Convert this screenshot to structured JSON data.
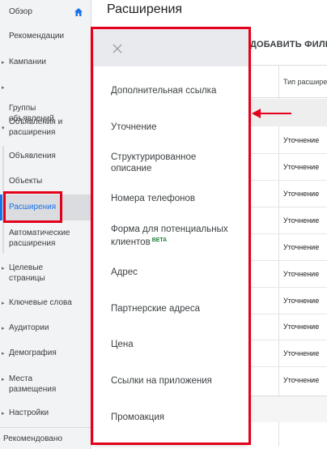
{
  "sidebar": {
    "items": [
      {
        "label": "Обзор"
      },
      {
        "label": "Рекомендации"
      },
      {
        "label": "Кампании"
      },
      {
        "label": "Группы\nобъявлений"
      },
      {
        "label": "Объявления и\nрасширения"
      },
      {
        "label": "Объявления"
      },
      {
        "label": "Объекты"
      },
      {
        "label": "Расширения"
      },
      {
        "label": "Автоматические\nрасширения"
      },
      {
        "label": "Целевые\nстраницы"
      },
      {
        "label": "Ключевые слова"
      },
      {
        "label": "Аудитории"
      },
      {
        "label": "Демография"
      },
      {
        "label": "Места\nразмещения"
      },
      {
        "label": "Настройки"
      }
    ],
    "footer_label": "Рекомендовано"
  },
  "main": {
    "title": "Расширения",
    "filter_label": "ДОБАВИТЬ ФИЛЬТР",
    "column_header": "Тип расширения",
    "cells": [
      "Уточнение",
      "Уточнение",
      "Уточнение",
      "Уточнение",
      "Уточнение",
      "Уточнение",
      "Уточнение",
      "Уточнение",
      "Уточнение",
      "Уточнение"
    ]
  },
  "dropdown": {
    "items": [
      {
        "label": "Дополнительная ссылка"
      },
      {
        "label": "Уточнение"
      },
      {
        "label": "Структурированное\nописание"
      },
      {
        "label": "Номера телефонов"
      },
      {
        "label": "Форма для потенциальных\nклиентов",
        "badge": "BETA"
      },
      {
        "label": "Адрес"
      },
      {
        "label": "Партнерские адреса"
      },
      {
        "label": "Цена"
      },
      {
        "label": "Ссылки на приложения"
      },
      {
        "label": "Промоакция"
      }
    ]
  },
  "colors": {
    "accent": "#1a73e8",
    "annotation_red": "#e3001b",
    "beta_green": "#188038"
  }
}
